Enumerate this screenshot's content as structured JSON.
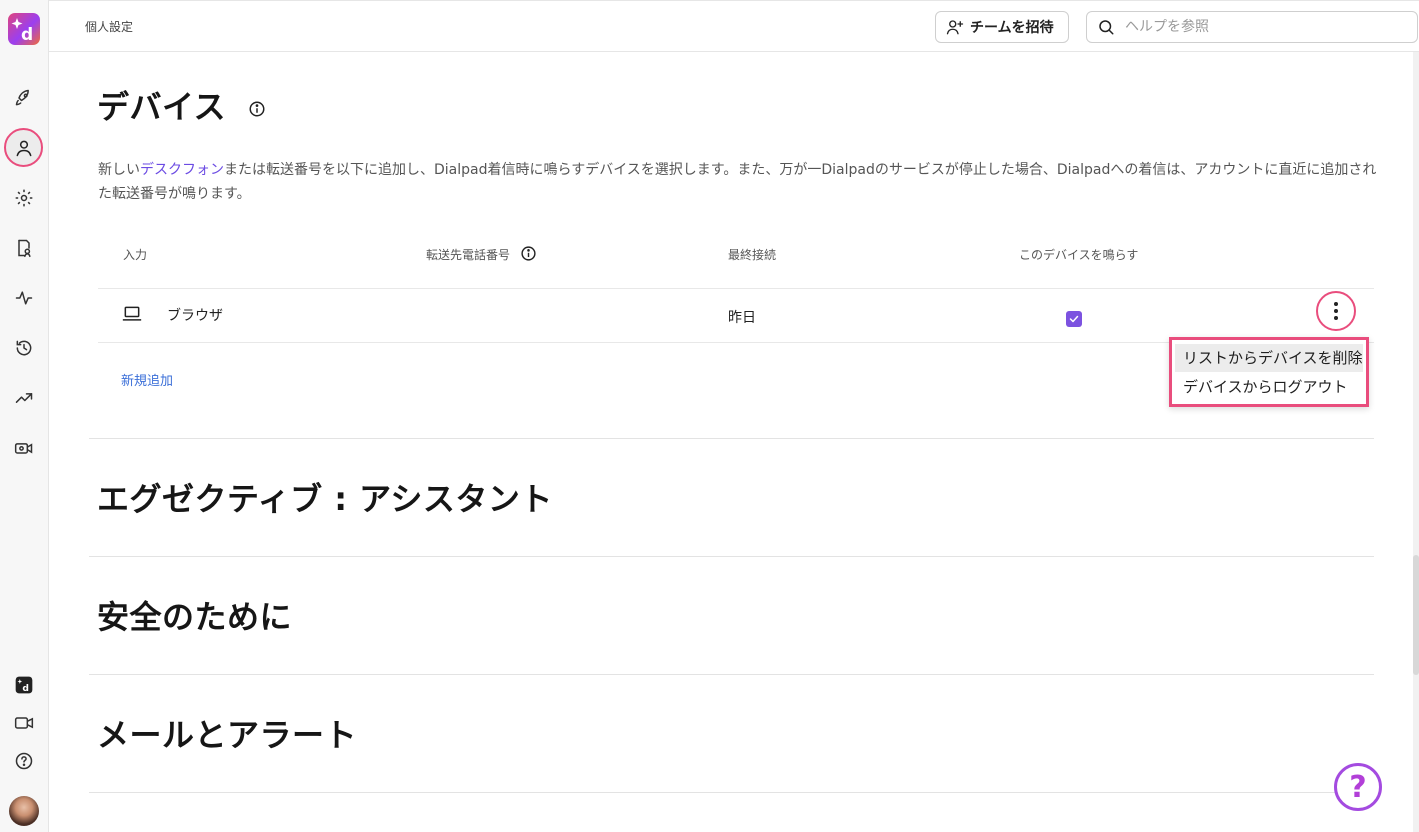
{
  "topbar": {
    "breadcrumb": "個人設定",
    "invite_label": "チームを招待",
    "search_placeholder": "ヘルプを参照"
  },
  "sidebar": {
    "items": [
      "rocket-icon",
      "user-icon",
      "gear-icon",
      "contacts-icon",
      "activity-icon",
      "history-icon",
      "trending-icon",
      "video-settings-icon"
    ],
    "bottom_items": [
      "dialpad-app-icon",
      "video-icon",
      "help-circle-icon",
      "avatar"
    ]
  },
  "devices": {
    "title": "デバイス",
    "desc_before": "新しい",
    "desc_link": "デスクフォン",
    "desc_after": "または転送番号を以下に追加し、Dialpad着信時に鳴らすデバイスを選択します。また、万が一Dialpadのサービスが停止した場合、Dialpadへの着信は、アカウントに直近に追加された転送番号が鳴ります。",
    "columns": {
      "input": "入力",
      "forward": "転送先電話番号",
      "last_connected": "最終接続",
      "ring": "このデバイスを鳴らす"
    },
    "rows": [
      {
        "name": "ブラウザ",
        "last_connected": "昨日",
        "ring": true
      }
    ],
    "add_new": "新規追加",
    "menu": {
      "remove": "リストからデバイスを削除",
      "logout": "デバイスからログアウト"
    }
  },
  "sections": {
    "executive": "エグゼクティブ : アシスタント",
    "safety": "安全のために",
    "mail": "メールとアラート"
  },
  "help_fab": "?",
  "colors": {
    "accent": "#7c52e0",
    "highlight": "#e94d7d",
    "link": "#3b6fd8"
  }
}
